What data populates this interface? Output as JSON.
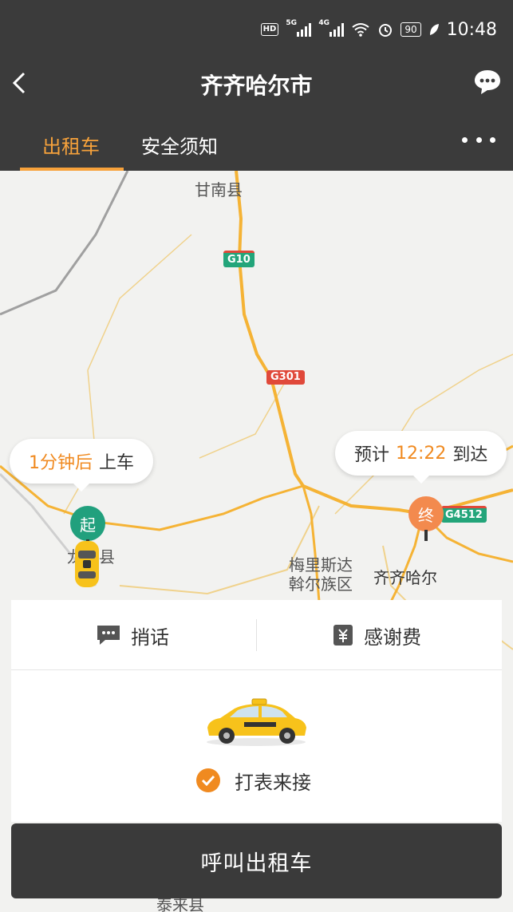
{
  "status_bar": {
    "hd": "HD",
    "sim_5g": "5G",
    "sim_4g": "4G",
    "battery": "90",
    "time": "10:48"
  },
  "header": {
    "title": "齐齐哈尔市"
  },
  "tabs": [
    {
      "label": "出租车",
      "active": true
    },
    {
      "label": "安全须知",
      "active": false
    }
  ],
  "map": {
    "place_labels": {
      "gannan": "甘南县",
      "city_district_1": "梅里斯达",
      "city_district_2": "斡尔族区",
      "city": "齐齐哈尔",
      "taila": "泰来县",
      "longjiang_partial": "龙江县"
    },
    "road_badges": {
      "g10": "G10",
      "g301": "G301",
      "g4512": "G4512"
    },
    "pickup_bubble": {
      "highlight": "1分钟后",
      "text": "上车"
    },
    "arrival_bubble": {
      "prefix": "预计",
      "time": "12:22",
      "suffix": "到达"
    },
    "start_pin": "起",
    "end_pin": "终"
  },
  "panel": {
    "actions": {
      "message": "捎话",
      "thanks_fee": "感谢费"
    },
    "meter_option": "打表来接",
    "meter_checked": true
  },
  "call_button": "呼叫出租车",
  "colors": {
    "accent": "#f08a20",
    "header_bg": "#3b3b3b",
    "start_green": "#21a07d",
    "end_orange": "#f38a4e"
  }
}
